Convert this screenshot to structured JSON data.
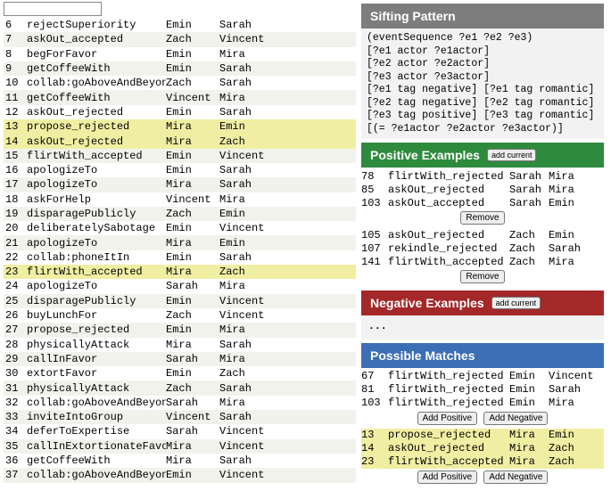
{
  "events": [
    {
      "idx": 6,
      "evt": "rejectSuperiority",
      "a1": "Emin",
      "a2": "Sarah"
    },
    {
      "idx": 7,
      "evt": "askOut_accepted",
      "a1": "Zach",
      "a2": "Vincent"
    },
    {
      "idx": 8,
      "evt": "begForFavor",
      "a1": "Emin",
      "a2": "Mira"
    },
    {
      "idx": 9,
      "evt": "getCoffeeWith",
      "a1": "Emin",
      "a2": "Sarah"
    },
    {
      "idx": 10,
      "evt": "collab:goAboveAndBeyond",
      "a1": "Zach",
      "a2": "Sarah"
    },
    {
      "idx": 11,
      "evt": "getCoffeeWith",
      "a1": "Vincent",
      "a2": "Mira"
    },
    {
      "idx": 12,
      "evt": "askOut_rejected",
      "a1": "Emin",
      "a2": "Sarah"
    },
    {
      "idx": 13,
      "evt": "propose_rejected",
      "a1": "Mira",
      "a2": "Emin",
      "hl": true
    },
    {
      "idx": 14,
      "evt": "askOut_rejected",
      "a1": "Mira",
      "a2": "Zach",
      "hl": true
    },
    {
      "idx": 15,
      "evt": "flirtWith_accepted",
      "a1": "Emin",
      "a2": "Vincent"
    },
    {
      "idx": 16,
      "evt": "apologizeTo",
      "a1": "Emin",
      "a2": "Sarah"
    },
    {
      "idx": 17,
      "evt": "apologizeTo",
      "a1": "Mira",
      "a2": "Sarah"
    },
    {
      "idx": 18,
      "evt": "askForHelp",
      "a1": "Vincent",
      "a2": "Mira"
    },
    {
      "idx": 19,
      "evt": "disparagePublicly",
      "a1": "Zach",
      "a2": "Emin"
    },
    {
      "idx": 20,
      "evt": "deliberatelySabotage",
      "a1": "Emin",
      "a2": "Vincent"
    },
    {
      "idx": 21,
      "evt": "apologizeTo",
      "a1": "Mira",
      "a2": "Emin"
    },
    {
      "idx": 22,
      "evt": "collab:phoneItIn",
      "a1": "Emin",
      "a2": "Sarah"
    },
    {
      "idx": 23,
      "evt": "flirtWith_accepted",
      "a1": "Mira",
      "a2": "Zach",
      "hl": true
    },
    {
      "idx": 24,
      "evt": "apologizeTo",
      "a1": "Sarah",
      "a2": "Mira"
    },
    {
      "idx": 25,
      "evt": "disparagePublicly",
      "a1": "Emin",
      "a2": "Vincent"
    },
    {
      "idx": 26,
      "evt": "buyLunchFor",
      "a1": "Zach",
      "a2": "Vincent"
    },
    {
      "idx": 27,
      "evt": "propose_rejected",
      "a1": "Emin",
      "a2": "Mira"
    },
    {
      "idx": 28,
      "evt": "physicallyAttack",
      "a1": "Mira",
      "a2": "Sarah"
    },
    {
      "idx": 29,
      "evt": "callInFavor",
      "a1": "Sarah",
      "a2": "Mira"
    },
    {
      "idx": 30,
      "evt": "extortFavor",
      "a1": "Emin",
      "a2": "Zach"
    },
    {
      "idx": 31,
      "evt": "physicallyAttack",
      "a1": "Zach",
      "a2": "Sarah"
    },
    {
      "idx": 32,
      "evt": "collab:goAboveAndBeyond",
      "a1": "Sarah",
      "a2": "Mira"
    },
    {
      "idx": 33,
      "evt": "inviteIntoGroup",
      "a1": "Vincent",
      "a2": "Sarah"
    },
    {
      "idx": 34,
      "evt": "deferToExpertise",
      "a1": "Sarah",
      "a2": "Vincent"
    },
    {
      "idx": 35,
      "evt": "callInExtortionateFavor",
      "a1": "Mira",
      "a2": "Vincent"
    },
    {
      "idx": 36,
      "evt": "getCoffeeWith",
      "a1": "Mira",
      "a2": "Sarah"
    },
    {
      "idx": 37,
      "evt": "collab:goAboveAndBeyond",
      "a1": "Emin",
      "a2": "Vincent"
    }
  ],
  "sifting": {
    "title": "Sifting Pattern",
    "body": "(eventSequence ?e1 ?e2 ?e3)\n[?e1 actor ?e1actor]\n[?e2 actor ?e2actor]\n[?e3 actor ?e3actor]\n[?e1 tag negative] [?e1 tag romantic]\n[?e2 tag negative] [?e2 tag romantic]\n[?e3 tag positive] [?e3 tag romantic]\n[(= ?e1actor ?e2actor ?e3actor)]"
  },
  "positive": {
    "title": "Positive Examples",
    "add_label": "add current",
    "groups": [
      {
        "rows": [
          {
            "idx": 78,
            "evt": "flirtWith_rejected",
            "a1": "Sarah",
            "a2": "Mira"
          },
          {
            "idx": 85,
            "evt": "askOut_rejected",
            "a1": "Sarah",
            "a2": "Mira"
          },
          {
            "idx": 103,
            "evt": "askOut_accepted",
            "a1": "Sarah",
            "a2": "Emin"
          }
        ],
        "remove": "Remove"
      },
      {
        "rows": [
          {
            "idx": 105,
            "evt": "askOut_rejected",
            "a1": "Zach",
            "a2": "Emin"
          },
          {
            "idx": 107,
            "evt": "rekindle_rejected",
            "a1": "Zach",
            "a2": "Sarah"
          },
          {
            "idx": 141,
            "evt": "flirtWith_accepted",
            "a1": "Zach",
            "a2": "Mira"
          }
        ],
        "remove": "Remove"
      }
    ]
  },
  "negative": {
    "title": "Negative Examples",
    "add_label": "add current",
    "body": "..."
  },
  "possible": {
    "title": "Possible Matches",
    "groups": [
      {
        "rows": [
          {
            "idx": 67,
            "evt": "flirtWith_rejected",
            "a1": "Emin",
            "a2": "Vincent"
          },
          {
            "idx": 81,
            "evt": "flirtWith_rejected",
            "a1": "Emin",
            "a2": "Sarah"
          },
          {
            "idx": 103,
            "evt": "flirtWith_rejected",
            "a1": "Emin",
            "a2": "Mira"
          }
        ],
        "btns": [
          "Add Positive",
          "Add Negative"
        ]
      },
      {
        "rows": [
          {
            "idx": 13,
            "evt": "propose_rejected",
            "a1": "Mira",
            "a2": "Emin",
            "hl": true
          },
          {
            "idx": 14,
            "evt": "askOut_rejected",
            "a1": "Mira",
            "a2": "Zach",
            "hl": true
          },
          {
            "idx": 23,
            "evt": "flirtWith_accepted",
            "a1": "Mira",
            "a2": "Zach",
            "hl": true
          }
        ],
        "btns": [
          "Add Positive",
          "Add Negative"
        ]
      }
    ]
  }
}
